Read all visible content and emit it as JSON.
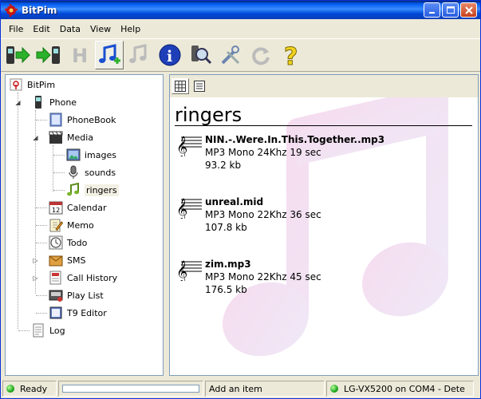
{
  "window": {
    "title": "BitPim"
  },
  "menu": [
    "File",
    "Edit",
    "Data",
    "View",
    "Help"
  ],
  "toolbar": {
    "buttons": [
      "get-phone-data",
      "send-phone-data",
      "html-view",
      "add-ringer",
      "delete-ringer",
      "info",
      "detect-phone",
      "settings",
      "refresh",
      "help"
    ]
  },
  "tree": {
    "root": "BitPim",
    "phone": "Phone",
    "phonebook": "PhoneBook",
    "media": "Media",
    "images": "images",
    "sounds": "sounds",
    "ringers": "ringers",
    "calendar": "Calendar",
    "calendar_date": "12",
    "memo": "Memo",
    "todo": "Todo",
    "sms": "SMS",
    "call_history": "Call History",
    "play_list": "Play List",
    "t9_editor": "T9 Editor",
    "log": "Log"
  },
  "ringers_view": {
    "heading": "ringers",
    "items": [
      {
        "name": "NIN.-.Were.In.This.Together..mp3",
        "meta": "MP3 Mono 24Khz 19 sec",
        "size": "93.2 kb"
      },
      {
        "name": "unreal.mid",
        "meta": "MP3 Mono 22Khz 36 sec",
        "size": "107.8 kb"
      },
      {
        "name": "zim.mp3",
        "meta": "MP3 Mono 22Khz 45 sec",
        "size": "176.5 kb"
      }
    ]
  },
  "status": {
    "ready": "Ready",
    "hint": "Add an item",
    "phone": "LG-VX5200 on COM4 - Dete",
    "progress": 0
  },
  "colors": {
    "titlebar": "#0058ee",
    "accent": "#2a9f2a",
    "selection": "#f1f0e3"
  }
}
